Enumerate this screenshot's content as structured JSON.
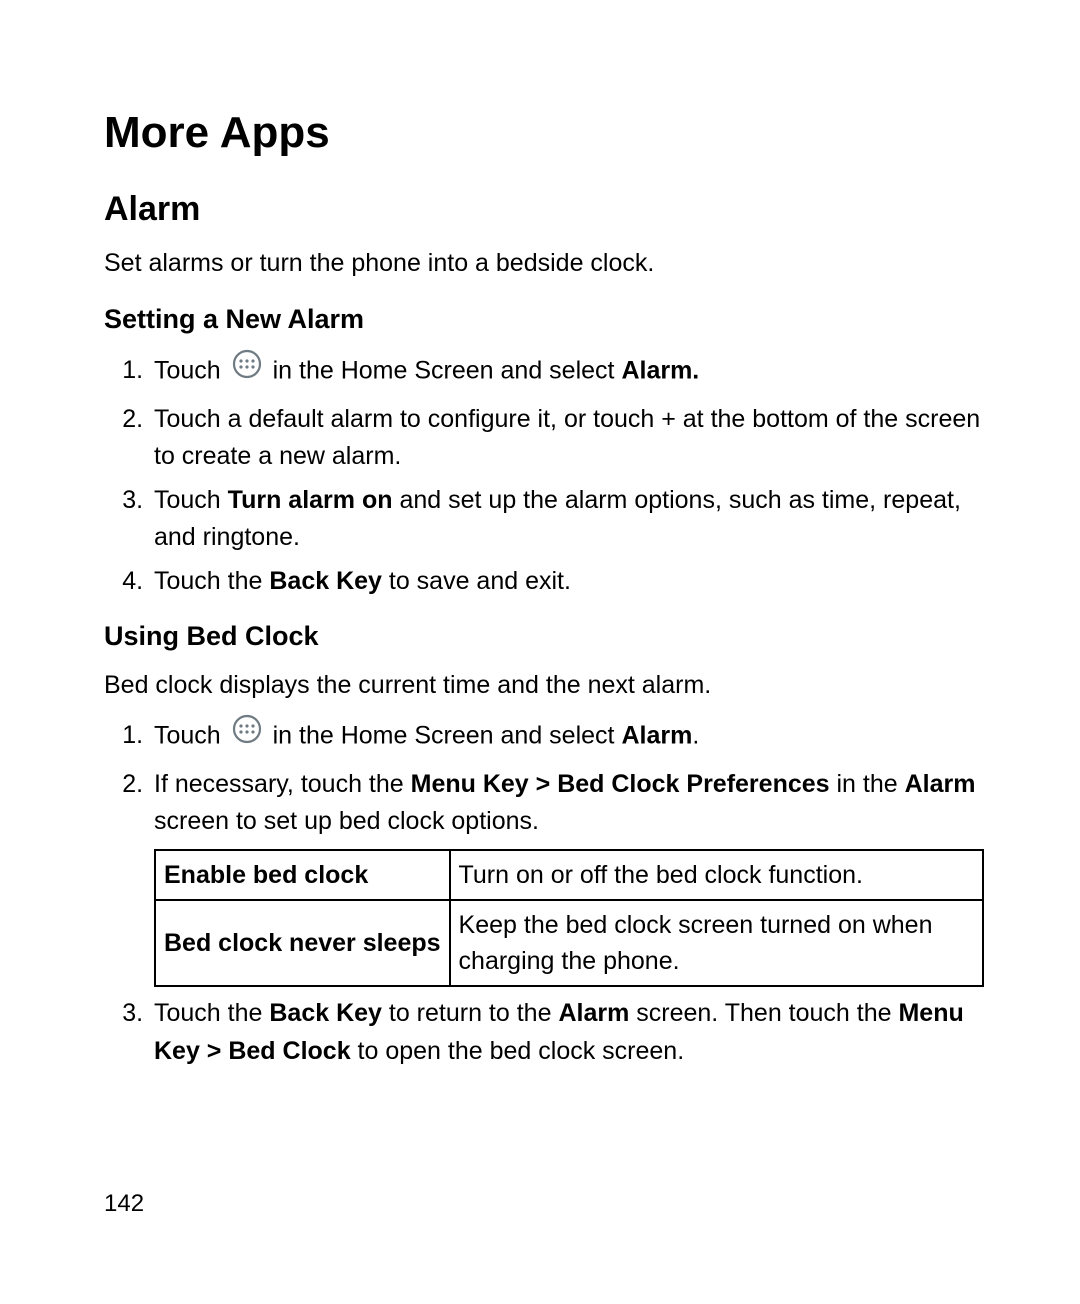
{
  "page_number": "142",
  "title": "More Apps",
  "section_alarm": {
    "heading": "Alarm",
    "intro": "Set alarms or turn the phone into a bedside clock.",
    "set_new": {
      "heading": "Setting a New Alarm",
      "step1_a": "Touch ",
      "step1_b": " in the Home Screen and select ",
      "step1_c": "Alarm.",
      "step2": "Touch a default alarm to configure it, or touch + at the bottom of the screen to create a new alarm.",
      "step3_a": "Touch ",
      "step3_b": "Turn alarm on",
      "step3_c": " and set up the alarm options, such as time, repeat, and ringtone.",
      "step4_a": "Touch the ",
      "step4_b": "Back Key",
      "step4_c": " to save and exit."
    },
    "bed_clock": {
      "heading": "Using Bed Clock",
      "intro": "Bed clock displays the current time and the next alarm.",
      "step1_a": "Touch ",
      "step1_b": " in the Home Screen and select ",
      "step1_c": "Alarm",
      "step1_d": ".",
      "step2_a": "If necessary, touch the ",
      "step2_b": "Menu Key > Bed Clock Preferences",
      "step2_c": " in the ",
      "step2_d": "Alarm",
      "step2_e": " screen to set up bed clock options.",
      "table": {
        "row1": {
          "label": "Enable bed clock",
          "desc": "Turn on or off the bed clock function."
        },
        "row2": {
          "label": "Bed clock never sleeps",
          "desc": "Keep the bed clock screen turned on when charging the phone."
        }
      },
      "step3_a": "Touch the ",
      "step3_b": "Back Key",
      "step3_c": " to return to the ",
      "step3_d": "Alarm",
      "step3_e": " screen. Then touch the ",
      "step3_f": "Menu Key > Bed Clock",
      "step3_g": " to open the bed clock screen."
    }
  }
}
